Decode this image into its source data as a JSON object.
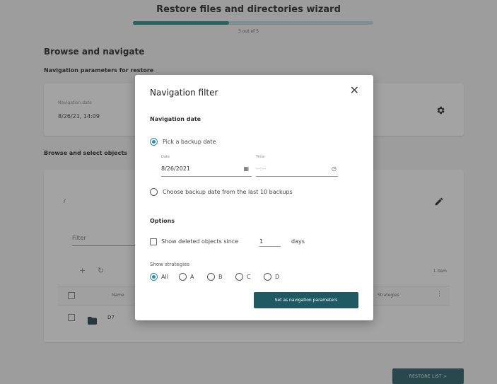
{
  "wizard": {
    "title": "Restore files and directories wizard",
    "step_text": "3 out of 5",
    "progress": 0.4
  },
  "main": {
    "section_title": "Browse and navigate",
    "nav_params_title": "Navigation parameters for restore",
    "nav_date_label": "Navigation date",
    "nav_date_value": "8/26/21, 14:09",
    "browse_title": "Browse and select objects",
    "path_label": "/",
    "filter_placeholder": "Filter",
    "rows_label": "1 item",
    "table": {
      "columns": [
        "Name",
        "Strategies"
      ],
      "rows": [
        {
          "name": "D7"
        }
      ]
    },
    "restore_button": "RESTORE LIST >"
  },
  "modal": {
    "title": "Navigation filter",
    "nav_date_section": "Navigation date",
    "option_pick": "Pick a backup date",
    "date_label": "Date",
    "date_value": "8/26/2021",
    "time_label": "Time",
    "time_placeholder": "--:--",
    "option_last": "Choose backup date from the last 10 backups",
    "options_section": "Options",
    "show_deleted_label": "Show deleted objects since",
    "days_value": "1",
    "days_suffix": "days",
    "strategies_label": "Show strategies",
    "strategies": [
      "All",
      "A",
      "B",
      "C",
      "D"
    ],
    "selected_strategy": "All",
    "set_button": "Set as navigation parameters"
  },
  "colors": {
    "accent": "#1e8c86",
    "primary_button": "#1f5a62",
    "radio_selected": "#2a8fbd"
  }
}
